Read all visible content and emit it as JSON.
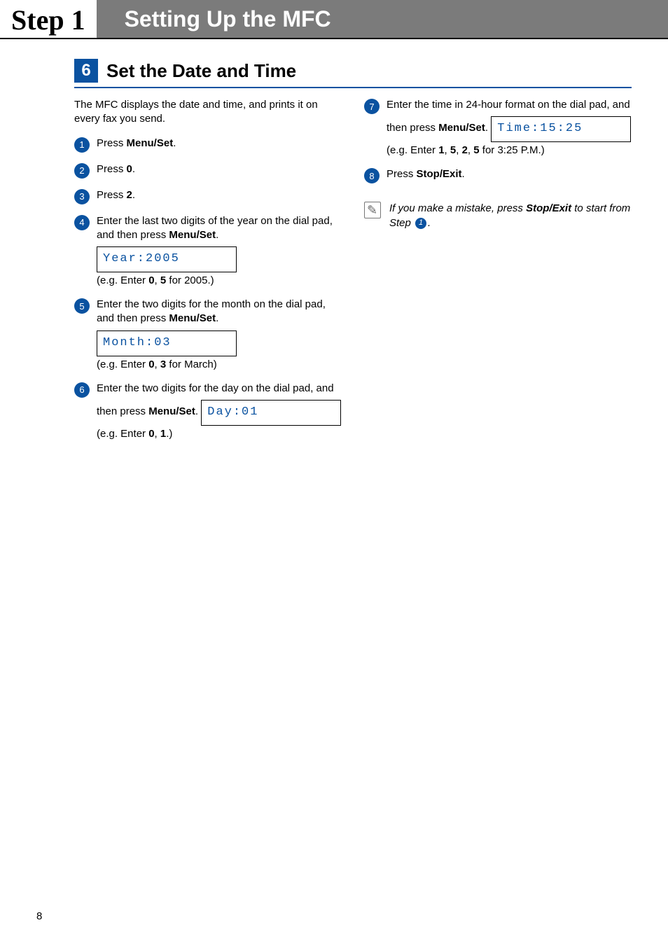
{
  "header": {
    "step_label": "Step 1",
    "title": "Setting Up the MFC"
  },
  "section": {
    "number": "6",
    "title": "Set the Date and Time"
  },
  "intro": "The MFC displays the date and time, and prints it on every fax you send.",
  "steps": {
    "s1": {
      "num": "1",
      "preA": "Press ",
      "boldA": "Menu/Set",
      "postA": "."
    },
    "s2": {
      "num": "2",
      "preA": "Press ",
      "boldA": "0",
      "postA": "."
    },
    "s3": {
      "num": "3",
      "preA": "Press ",
      "boldA": "2",
      "postA": "."
    },
    "s4": {
      "num": "4",
      "line1a": "Enter the last two digits of the year on the dial pad, and then press ",
      "line1bold": "Menu/Set",
      "line1b": ".",
      "lcd": "Year:2005",
      "egA": "(e.g. Enter ",
      "egB1": "0",
      "egC": ", ",
      "egB2": "5",
      "egD": " for 2005.)"
    },
    "s5": {
      "num": "5",
      "line1a": "Enter the two digits for the month on the dial pad, and then press ",
      "line1bold": "Menu/Set",
      "line1b": ".",
      "lcd": "Month:03",
      "egA": "(e.g. Enter ",
      "egB1": "0",
      "egC": ", ",
      "egB2": "3",
      "egD": " for March)"
    },
    "s6": {
      "num": "6",
      "line1a": "Enter the two digits for the day on the dial pad, and then press ",
      "line1bold": "Menu/Set",
      "line1b": ".",
      "lcd": "Day:01",
      "egA": "(e.g. Enter ",
      "egB1": "0",
      "egC": ", ",
      "egB2": "1",
      "egD": ".)"
    },
    "s7": {
      "num": "7",
      "line1a": "Enter the time in 24-hour format on the dial pad, and then press ",
      "line1bold": "Menu/Set",
      "line1b": ".",
      "lcd": "Time:15:25",
      "egA": "(e.g. Enter ",
      "egB1": "1",
      "egC1": ", ",
      "egB2": "5",
      "egC2": ", ",
      "egB3": "2",
      "egC3": ", ",
      "egB4": "5",
      "egD": " for 3:25 P.M.)"
    },
    "s8": {
      "num": "8",
      "preA": "Press ",
      "boldA": "Stop/Exit",
      "postA": "."
    }
  },
  "note": {
    "a": "If you make a mistake, press ",
    "bold": "Stop/Exit",
    "b": " to start from Step ",
    "stepref": "1",
    "c": "."
  },
  "page_number": "8"
}
